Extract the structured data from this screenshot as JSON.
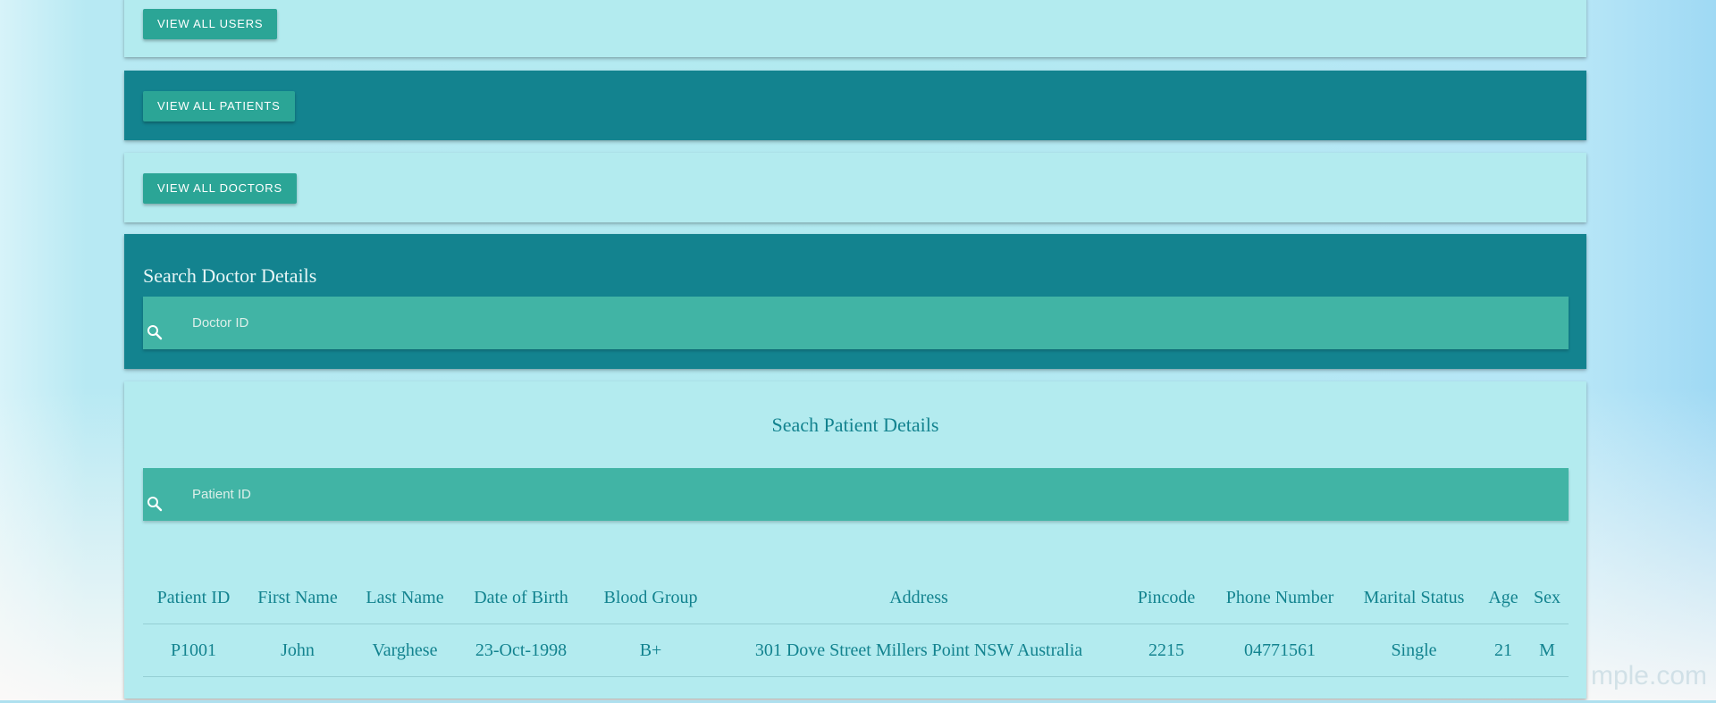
{
  "buttons": {
    "view_all_users": "VIEW ALL USERS",
    "view_all_patients": "VIEW ALL PATIENTS",
    "view_all_doctors": "VIEW ALL DOCTORS"
  },
  "doctor_search": {
    "title": "Search Doctor Details",
    "placeholder": "Doctor ID",
    "value": ""
  },
  "patient_search": {
    "title": "Seach Patient Details",
    "placeholder": "Patient ID",
    "value": ""
  },
  "patients_table": {
    "columns": [
      "Patient ID",
      "First Name",
      "Last Name",
      "Date of Birth",
      "Blood Group",
      "Address",
      "Pincode",
      "Phone Number",
      "Marital Status",
      "Age",
      "Sex"
    ],
    "rows": [
      [
        "P1001",
        "John",
        "Varghese",
        "23-Oct-1998",
        "B+",
        "301 Dove Street Millers Point NSW Australia",
        "2215",
        "04771561",
        "Single",
        "21",
        "M"
      ]
    ]
  },
  "watermark": "mple.com",
  "icons": {
    "search": "search-icon"
  },
  "colors": {
    "card_light": "#b3ebef",
    "card_dark": "#13838f",
    "button": "#2ba596",
    "search_bar": "#41b4a5",
    "table_text": "#13838f"
  }
}
